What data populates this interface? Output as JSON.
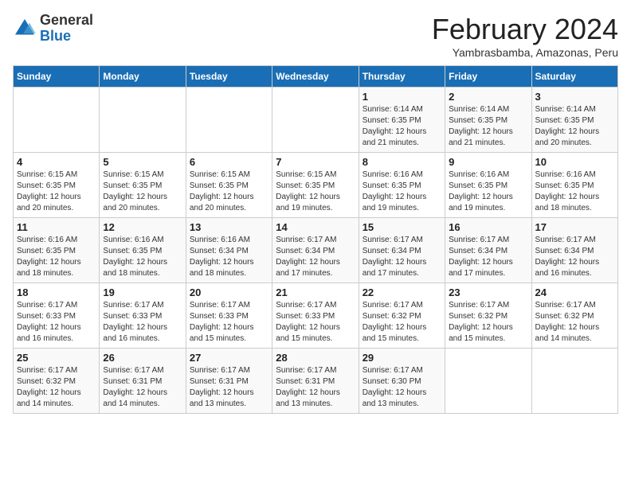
{
  "logo": {
    "general": "General",
    "blue": "Blue"
  },
  "title": {
    "month_year": "February 2024",
    "location": "Yambrasbamba, Amazonas, Peru"
  },
  "days_of_week": [
    "Sunday",
    "Monday",
    "Tuesday",
    "Wednesday",
    "Thursday",
    "Friday",
    "Saturday"
  ],
  "weeks": [
    [
      {
        "day": "",
        "info": ""
      },
      {
        "day": "",
        "info": ""
      },
      {
        "day": "",
        "info": ""
      },
      {
        "day": "",
        "info": ""
      },
      {
        "day": "1",
        "info": "Sunrise: 6:14 AM\nSunset: 6:35 PM\nDaylight: 12 hours\nand 21 minutes."
      },
      {
        "day": "2",
        "info": "Sunrise: 6:14 AM\nSunset: 6:35 PM\nDaylight: 12 hours\nand 21 minutes."
      },
      {
        "day": "3",
        "info": "Sunrise: 6:14 AM\nSunset: 6:35 PM\nDaylight: 12 hours\nand 20 minutes."
      }
    ],
    [
      {
        "day": "4",
        "info": "Sunrise: 6:15 AM\nSunset: 6:35 PM\nDaylight: 12 hours\nand 20 minutes."
      },
      {
        "day": "5",
        "info": "Sunrise: 6:15 AM\nSunset: 6:35 PM\nDaylight: 12 hours\nand 20 minutes."
      },
      {
        "day": "6",
        "info": "Sunrise: 6:15 AM\nSunset: 6:35 PM\nDaylight: 12 hours\nand 20 minutes."
      },
      {
        "day": "7",
        "info": "Sunrise: 6:15 AM\nSunset: 6:35 PM\nDaylight: 12 hours\nand 19 minutes."
      },
      {
        "day": "8",
        "info": "Sunrise: 6:16 AM\nSunset: 6:35 PM\nDaylight: 12 hours\nand 19 minutes."
      },
      {
        "day": "9",
        "info": "Sunrise: 6:16 AM\nSunset: 6:35 PM\nDaylight: 12 hours\nand 19 minutes."
      },
      {
        "day": "10",
        "info": "Sunrise: 6:16 AM\nSunset: 6:35 PM\nDaylight: 12 hours\nand 18 minutes."
      }
    ],
    [
      {
        "day": "11",
        "info": "Sunrise: 6:16 AM\nSunset: 6:35 PM\nDaylight: 12 hours\nand 18 minutes."
      },
      {
        "day": "12",
        "info": "Sunrise: 6:16 AM\nSunset: 6:35 PM\nDaylight: 12 hours\nand 18 minutes."
      },
      {
        "day": "13",
        "info": "Sunrise: 6:16 AM\nSunset: 6:34 PM\nDaylight: 12 hours\nand 18 minutes."
      },
      {
        "day": "14",
        "info": "Sunrise: 6:17 AM\nSunset: 6:34 PM\nDaylight: 12 hours\nand 17 minutes."
      },
      {
        "day": "15",
        "info": "Sunrise: 6:17 AM\nSunset: 6:34 PM\nDaylight: 12 hours\nand 17 minutes."
      },
      {
        "day": "16",
        "info": "Sunrise: 6:17 AM\nSunset: 6:34 PM\nDaylight: 12 hours\nand 17 minutes."
      },
      {
        "day": "17",
        "info": "Sunrise: 6:17 AM\nSunset: 6:34 PM\nDaylight: 12 hours\nand 16 minutes."
      }
    ],
    [
      {
        "day": "18",
        "info": "Sunrise: 6:17 AM\nSunset: 6:33 PM\nDaylight: 12 hours\nand 16 minutes."
      },
      {
        "day": "19",
        "info": "Sunrise: 6:17 AM\nSunset: 6:33 PM\nDaylight: 12 hours\nand 16 minutes."
      },
      {
        "day": "20",
        "info": "Sunrise: 6:17 AM\nSunset: 6:33 PM\nDaylight: 12 hours\nand 15 minutes."
      },
      {
        "day": "21",
        "info": "Sunrise: 6:17 AM\nSunset: 6:33 PM\nDaylight: 12 hours\nand 15 minutes."
      },
      {
        "day": "22",
        "info": "Sunrise: 6:17 AM\nSunset: 6:32 PM\nDaylight: 12 hours\nand 15 minutes."
      },
      {
        "day": "23",
        "info": "Sunrise: 6:17 AM\nSunset: 6:32 PM\nDaylight: 12 hours\nand 15 minutes."
      },
      {
        "day": "24",
        "info": "Sunrise: 6:17 AM\nSunset: 6:32 PM\nDaylight: 12 hours\nand 14 minutes."
      }
    ],
    [
      {
        "day": "25",
        "info": "Sunrise: 6:17 AM\nSunset: 6:32 PM\nDaylight: 12 hours\nand 14 minutes."
      },
      {
        "day": "26",
        "info": "Sunrise: 6:17 AM\nSunset: 6:31 PM\nDaylight: 12 hours\nand 14 minutes."
      },
      {
        "day": "27",
        "info": "Sunrise: 6:17 AM\nSunset: 6:31 PM\nDaylight: 12 hours\nand 13 minutes."
      },
      {
        "day": "28",
        "info": "Sunrise: 6:17 AM\nSunset: 6:31 PM\nDaylight: 12 hours\nand 13 minutes."
      },
      {
        "day": "29",
        "info": "Sunrise: 6:17 AM\nSunset: 6:30 PM\nDaylight: 12 hours\nand 13 minutes."
      },
      {
        "day": "",
        "info": ""
      },
      {
        "day": "",
        "info": ""
      }
    ]
  ]
}
